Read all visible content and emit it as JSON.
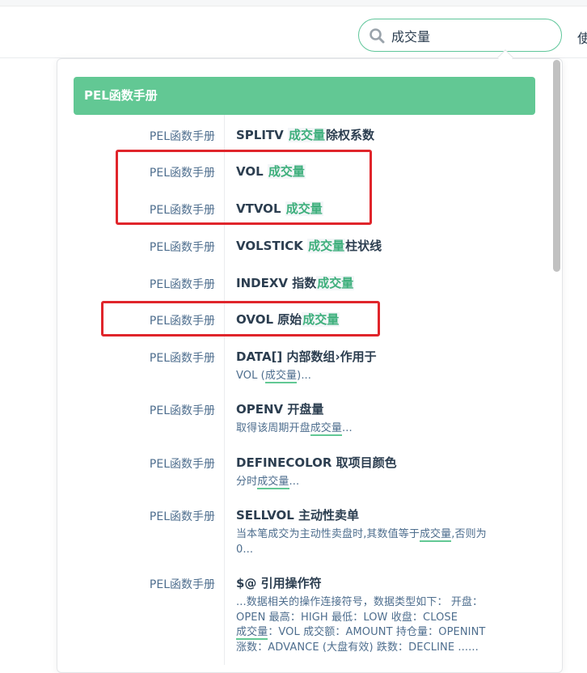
{
  "search": {
    "value": "成交量",
    "nav_cut": "使"
  },
  "section": {
    "title": "PEL函数手册"
  },
  "results": [
    {
      "category": "PEL函数手册",
      "pre": "SPLITV ",
      "hl": "成交量",
      "post": "除权系数"
    },
    {
      "category": "PEL函数手册",
      "pre": "VOL ",
      "hl": "成交量",
      "post": ""
    },
    {
      "category": "PEL函数手册",
      "pre": "VTVOL ",
      "hl": "成交量",
      "post": ""
    },
    {
      "category": "PEL函数手册",
      "pre": "VOLSTICK ",
      "hl": "成交量",
      "post": "柱状线"
    },
    {
      "category": "PEL函数手册",
      "pre": "INDEXV 指数",
      "hl": "成交量",
      "post": ""
    },
    {
      "category": "PEL函数手册",
      "pre": "OVOL 原始",
      "hl": "成交量",
      "post": ""
    },
    {
      "category": "PEL函数手册",
      "title": "DATA[] 内部数组›作用于",
      "excerpt": [
        {
          "pre": "VOL (",
          "hl": "成交量",
          "post": ")..."
        }
      ]
    },
    {
      "category": "PEL函数手册",
      "title": "OPENV 开盘量",
      "excerpt": [
        {
          "pre": "取得该周期开盘",
          "hl": "成交量",
          "post": "..."
        }
      ]
    },
    {
      "category": "PEL函数手册",
      "title": "DEFINECOLOR 取项目颜色",
      "excerpt": [
        {
          "pre": "分时",
          "hl": "成交量",
          "post": "..."
        }
      ]
    },
    {
      "category": "PEL函数手册",
      "title": "SELLVOL 主动性卖单",
      "excerpt": [
        {
          "pre": "当本笔成交为主动性卖盘时,其数值等于",
          "hl": "成交量",
          "post": ",否则为"
        },
        {
          "pre": "0..."
        }
      ]
    },
    {
      "category": "PEL函数手册",
      "title": "$@ 引用操作符",
      "excerpt": [
        {
          "pre": "...数据相关的操作连接符号，数据类型如下：    开盘："
        },
        {
          "pre": "OPEN   最高：HIGH   最低：LOW   收盘：CLOSE"
        },
        {
          "pre": "",
          "hl": "成交量",
          "post": "：VOL   成交额：AMOUNT   持仓量：OPENINT"
        },
        {
          "pre": "   涨数：ADVANCE (大盘有效)   跌数：DECLINE ......"
        }
      ]
    }
  ]
}
